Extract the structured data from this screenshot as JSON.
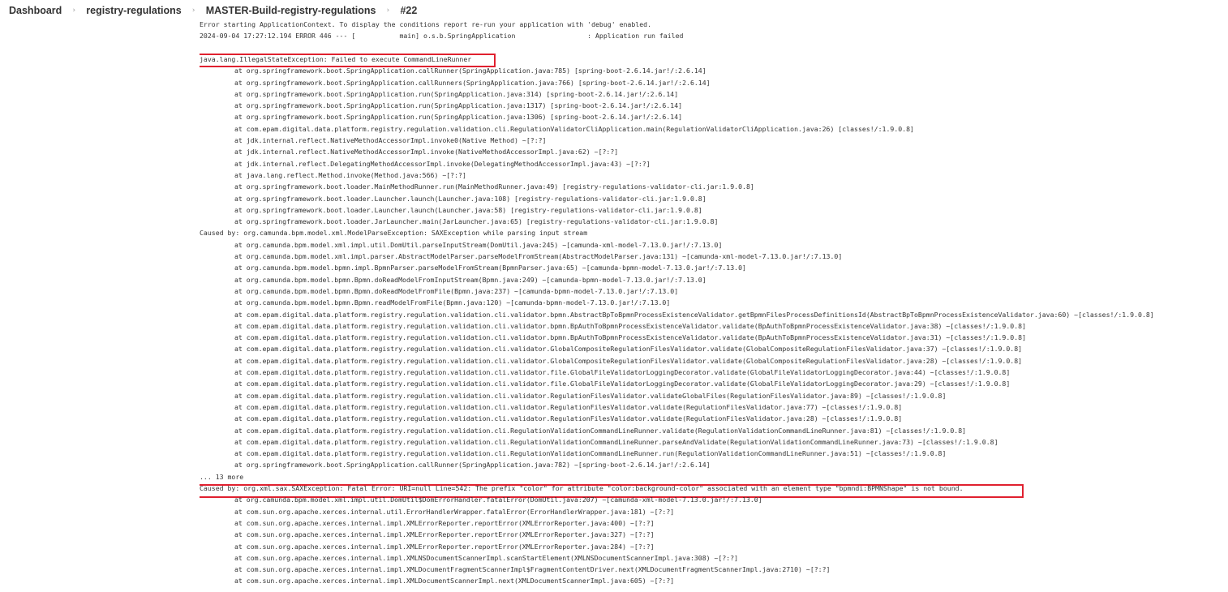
{
  "breadcrumb": {
    "items": [
      "Dashboard",
      "registry-regulations",
      "MASTER-Build-registry-regulations",
      "#22"
    ],
    "separator": "›"
  },
  "colors": {
    "highlight_border": "#e0202f",
    "log_text": "#333333",
    "background": "#ffffff"
  },
  "console": {
    "lines": [
      "Error starting ApplicationContext. To display the conditions report re-run your application with 'debug' enabled.",
      "2024-09-04 17:27:12.194 ERROR 446 --- [           main] o.s.b.SpringApplication                  : Application run failed",
      "",
      "java.lang.IllegalStateException: Failed to execute CommandLineRunner",
      "at org.springframework.boot.SpringApplication.callRunner(SpringApplication.java:785) [spring-boot-2.6.14.jar!/:2.6.14]",
      "at org.springframework.boot.SpringApplication.callRunners(SpringApplication.java:766) [spring-boot-2.6.14.jar!/:2.6.14]",
      "at org.springframework.boot.SpringApplication.run(SpringApplication.java:314) [spring-boot-2.6.14.jar!/:2.6.14]",
      "at org.springframework.boot.SpringApplication.run(SpringApplication.java:1317) [spring-boot-2.6.14.jar!/:2.6.14]",
      "at org.springframework.boot.SpringApplication.run(SpringApplication.java:1306) [spring-boot-2.6.14.jar!/:2.6.14]",
      "at com.epam.digital.data.platform.registry.regulation.validation.cli.RegulationValidatorCliApplication.main(RegulationValidatorCliApplication.java:26) [classes!/:1.9.0.8]",
      "at jdk.internal.reflect.NativeMethodAccessorImpl.invoke0(Native Method) ~[?:?]",
      "at jdk.internal.reflect.NativeMethodAccessorImpl.invoke(NativeMethodAccessorImpl.java:62) ~[?:?]",
      "at jdk.internal.reflect.DelegatingMethodAccessorImpl.invoke(DelegatingMethodAccessorImpl.java:43) ~[?:?]",
      "at java.lang.reflect.Method.invoke(Method.java:566) ~[?:?]",
      "at org.springframework.boot.loader.MainMethodRunner.run(MainMethodRunner.java:49) [registry-regulations-validator-cli.jar:1.9.0.8]",
      "at org.springframework.boot.loader.Launcher.launch(Launcher.java:108) [registry-regulations-validator-cli.jar:1.9.0.8]",
      "at org.springframework.boot.loader.Launcher.launch(Launcher.java:58) [registry-regulations-validator-cli.jar:1.9.0.8]",
      "at org.springframework.boot.loader.JarLauncher.main(JarLauncher.java:65) [registry-regulations-validator-cli.jar:1.9.0.8]",
      "Caused by: org.camunda.bpm.model.xml.ModelParseException: SAXException while parsing input stream",
      "at org.camunda.bpm.model.xml.impl.util.DomUtil.parseInputStream(DomUtil.java:245) ~[camunda-xml-model-7.13.0.jar!/:7.13.0]",
      "at org.camunda.bpm.model.xml.impl.parser.AbstractModelParser.parseModelFromStream(AbstractModelParser.java:131) ~[camunda-xml-model-7.13.0.jar!/:7.13.0]",
      "at org.camunda.bpm.model.bpmn.impl.BpmnParser.parseModelFromStream(BpmnParser.java:65) ~[camunda-bpmn-model-7.13.0.jar!/:7.13.0]",
      "at org.camunda.bpm.model.bpmn.Bpmn.doReadModelFromInputStream(Bpmn.java:249) ~[camunda-bpmn-model-7.13.0.jar!/:7.13.0]",
      "at org.camunda.bpm.model.bpmn.Bpmn.doReadModelFromFile(Bpmn.java:237) ~[camunda-bpmn-model-7.13.0.jar!/:7.13.0]",
      "at org.camunda.bpm.model.bpmn.Bpmn.readModelFromFile(Bpmn.java:120) ~[camunda-bpmn-model-7.13.0.jar!/:7.13.0]",
      "at com.epam.digital.data.platform.registry.regulation.validation.cli.validator.bpmn.AbstractBpToBpmnProcessExistenceValidator.getBpmnFilesProcessDefinitionsId(AbstractBpToBpmnProcessExistenceValidator.java:60) ~[classes!/:1.9.0.8]",
      "at com.epam.digital.data.platform.registry.regulation.validation.cli.validator.bpmn.BpAuthToBpmnProcessExistenceValidator.validate(BpAuthToBpmnProcessExistenceValidator.java:38) ~[classes!/:1.9.0.8]",
      "at com.epam.digital.data.platform.registry.regulation.validation.cli.validator.bpmn.BpAuthToBpmnProcessExistenceValidator.validate(BpAuthToBpmnProcessExistenceValidator.java:31) ~[classes!/:1.9.0.8]",
      "at com.epam.digital.data.platform.registry.regulation.validation.cli.validator.GlobalCompositeRegulationFilesValidator.validate(GlobalCompositeRegulationFilesValidator.java:37) ~[classes!/:1.9.0.8]",
      "at com.epam.digital.data.platform.registry.regulation.validation.cli.validator.GlobalCompositeRegulationFilesValidator.validate(GlobalCompositeRegulationFilesValidator.java:28) ~[classes!/:1.9.0.8]",
      "at com.epam.digital.data.platform.registry.regulation.validation.cli.validator.file.GlobalFileValidatorLoggingDecorator.validate(GlobalFileValidatorLoggingDecorator.java:44) ~[classes!/:1.9.0.8]",
      "at com.epam.digital.data.platform.registry.regulation.validation.cli.validator.file.GlobalFileValidatorLoggingDecorator.validate(GlobalFileValidatorLoggingDecorator.java:29) ~[classes!/:1.9.0.8]",
      "at com.epam.digital.data.platform.registry.regulation.validation.cli.validator.RegulationFilesValidator.validateGlobalFiles(RegulationFilesValidator.java:89) ~[classes!/:1.9.0.8]",
      "at com.epam.digital.data.platform.registry.regulation.validation.cli.validator.RegulationFilesValidator.validate(RegulationFilesValidator.java:77) ~[classes!/:1.9.0.8]",
      "at com.epam.digital.data.platform.registry.regulation.validation.cli.validator.RegulationFilesValidator.validate(RegulationFilesValidator.java:28) ~[classes!/:1.9.0.8]",
      "at com.epam.digital.data.platform.registry.regulation.validation.cli.RegulationValidationCommandLineRunner.validate(RegulationValidationCommandLineRunner.java:81) ~[classes!/:1.9.0.8]",
      "at com.epam.digital.data.platform.registry.regulation.validation.cli.RegulationValidationCommandLineRunner.parseAndValidate(RegulationValidationCommandLineRunner.java:73) ~[classes!/:1.9.0.8]",
      "at com.epam.digital.data.platform.registry.regulation.validation.cli.RegulationValidationCommandLineRunner.run(RegulationValidationCommandLineRunner.java:51) ~[classes!/:1.9.0.8]",
      "at org.springframework.boot.SpringApplication.callRunner(SpringApplication.java:782) ~[spring-boot-2.6.14.jar!/:2.6.14]",
      "... 13 more",
      "Caused by: org.xml.sax.SAXException: Fatal Error: URI=null Line=542: The prefix \"color\" for attribute \"color:background-color\" associated with an element type \"bpmndi:BPMNShape\" is not bound.",
      "at org.camunda.bpm.model.xml.impl.util.DomUtil$DomErrorHandler.fatalError(DomUtil.java:207) ~[camunda-xml-model-7.13.0.jar!/:7.13.0]",
      "at com.sun.org.apache.xerces.internal.util.ErrorHandlerWrapper.fatalError(ErrorHandlerWrapper.java:181) ~[?:?]",
      "at com.sun.org.apache.xerces.internal.impl.XMLErrorReporter.reportError(XMLErrorReporter.java:400) ~[?:?]",
      "at com.sun.org.apache.xerces.internal.impl.XMLErrorReporter.reportError(XMLErrorReporter.java:327) ~[?:?]",
      "at com.sun.org.apache.xerces.internal.impl.XMLErrorReporter.reportError(XMLErrorReporter.java:284) ~[?:?]",
      "at com.sun.org.apache.xerces.internal.impl.XMLNSDocumentScannerImpl.scanStartElement(XMLNSDocumentScannerImpl.java:308) ~[?:?]",
      "at com.sun.org.apache.xerces.internal.impl.XMLDocumentFragmentScannerImpl$FragmentContentDriver.next(XMLDocumentFragmentScannerImpl.java:2710) ~[?:?]",
      "at com.sun.org.apache.xerces.internal.impl.XMLDocumentScannerImpl.next(XMLDocumentScannerImpl.java:605) ~[?:?]"
    ]
  }
}
